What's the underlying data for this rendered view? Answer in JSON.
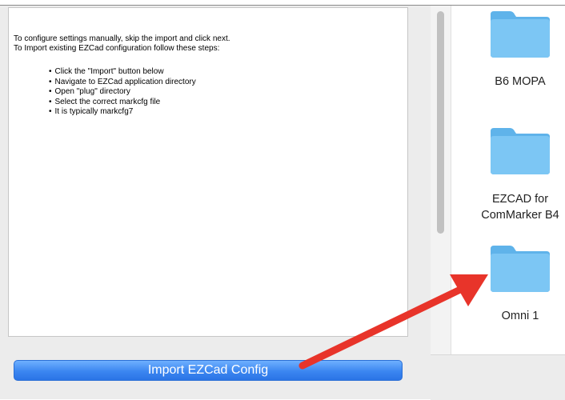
{
  "instructions": {
    "line1": "To configure settings manually, skip the import and click next.",
    "line2": "To Import existing EZCad configuration follow these steps:",
    "steps": [
      "Click the \"Import\" button below",
      "Navigate to EZCad application directory",
      "Open \"plug\" directory",
      "Select the correct markcfg file",
      "It is typically markcfg7"
    ]
  },
  "import_button": {
    "label": "Import EZCad Config"
  },
  "folders": [
    {
      "label_1": "B6 MOPA",
      "label_2": "",
      "icon": "folder-icon"
    },
    {
      "label_1": "EZCAD for",
      "label_2": "ComMarker B4",
      "icon": "folder-icon"
    },
    {
      "label_1": "Omni 1",
      "label_2": "",
      "icon": "folder-icon"
    }
  ],
  "annotation": {
    "arrow_color": "#e8342a",
    "icon": "red-arrow-icon"
  },
  "colors": {
    "button_blue": "#3b86f0",
    "folder_blue": "#7cc6f4"
  }
}
